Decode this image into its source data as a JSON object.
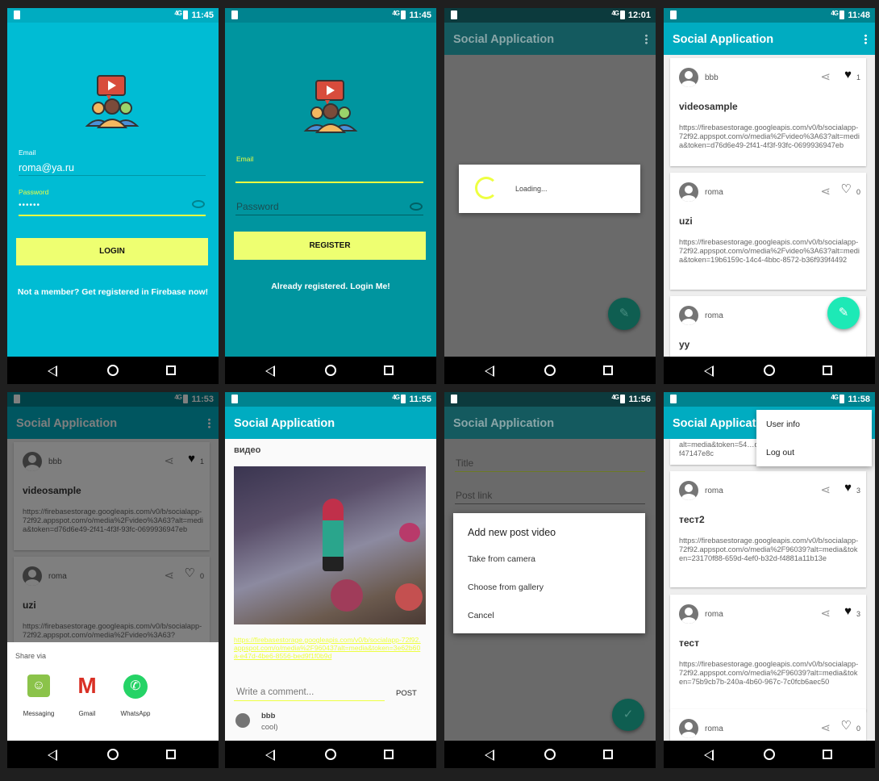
{
  "colors": {
    "cyan": "#00bcd4",
    "teal": "#00acc1",
    "dark_teal": "#00838f",
    "yellow": "#eeff41",
    "fab_green": "#1de9b6",
    "status_dark": "#0097a7"
  },
  "icons": {
    "logo": "video-people-logo",
    "share": "share-icon",
    "heart_filled": "heart-filled-icon",
    "heart_empty": "heart-outline-icon",
    "edit": "pencil-icon",
    "check": "check-icon",
    "eye": "eye-icon",
    "overflow": "kebab-menu-icon"
  },
  "screens": {
    "login": {
      "time": "11:45",
      "net": "4G",
      "email_label": "Email",
      "email_value": "roma@ya.ru",
      "password_label": "Password",
      "password_value": "••••••",
      "button": "LOGIN",
      "link": "Not a member? Get registered in Firebase now!"
    },
    "register": {
      "time": "11:45",
      "net": "4G",
      "email_label": "Email",
      "password_placeholder": "Password",
      "button": "REGISTER",
      "link": "Already registered. Login Me!"
    },
    "loading": {
      "time": "12:01",
      "net": "4G",
      "app_title": "Social Application",
      "dialog_text": "Loading..."
    },
    "feed": {
      "time": "11:48",
      "net": "4G",
      "app_title": "Social Application",
      "posts": [
        {
          "user": "bbb",
          "likes": "1",
          "liked": true,
          "title": "videosample",
          "url": "https://firebasestorage.googleapis.com/v0/b/socialapp-72f92.appspot.com/o/media%2Fvideo%3A63?alt=media&token=d76d6e49-2f41-4f3f-93fc-0699936947eb"
        },
        {
          "user": "roma",
          "likes": "0",
          "liked": false,
          "title": "uzi",
          "url": "https://firebasestorage.googleapis.com/v0/b/socialapp-72f92.appspot.com/o/media%2Fvideo%3A63?alt=media&token=19b6159c-14c4-4bbc-8572-b36f939f4492"
        },
        {
          "user": "roma",
          "likes": "",
          "liked": false,
          "title": "yy",
          "url": ""
        }
      ]
    },
    "share": {
      "time": "11:53",
      "net": "4G",
      "app_title": "Social Application",
      "title": "Share via",
      "apps": [
        "Messaging",
        "Gmail",
        "WhatsApp"
      ],
      "posts": [
        {
          "user": "bbb",
          "likes": "1",
          "liked": true,
          "title": "videosample",
          "url": "https://firebasestorage.googleapis.com/v0/b/socialapp-72f92.appspot.com/o/media%2Fvideo%3A63?alt=media&token=d76d6e49-2f41-4f3f-93fc-0699936947eb"
        },
        {
          "user": "roma",
          "likes": "0",
          "liked": false,
          "title": "uzi",
          "url": "https://firebasestorage.googleapis.com/v0/b/socialapp-72f92.appspot.com/o/media%2Fvideo%3A63?"
        }
      ]
    },
    "detail": {
      "time": "11:55",
      "net": "4G",
      "app_title": "Social Application",
      "post_title": "видео",
      "url": "https://firebasestorage.googleapis.com/v0/b/socialapp-72f92.appspot.com/o/media%2F960437alt=media&token=3e62b60a-e47d-4be6-8556-bed9f1f0b9d",
      "comment_placeholder": "Write a comment...",
      "post_button": "POST",
      "comment_user": "bbb",
      "comment_text": "cool)"
    },
    "new_post": {
      "time": "11:56",
      "net": "4G",
      "app_title": "Social Application",
      "title_placeholder": "Title",
      "link_placeholder": "Post link",
      "dialog_title": "Add new post video",
      "options": [
        "Take from camera",
        "Choose from gallery",
        "Cancel"
      ]
    },
    "menu": {
      "time": "11:58",
      "net": "4G",
      "app_title": "Social Application",
      "menu_items": [
        "User info",
        "Log out"
      ],
      "top_url": "alt=media&token=54…d91f47147e8c",
      "posts": [
        {
          "user": "roma",
          "likes": "3",
          "liked": true,
          "title": "тест2",
          "url": "https://firebasestorage.googleapis.com/v0/b/socialapp-72f92.appspot.com/o/media%2F96039?alt=media&token=23170f88-659d-4ef0-b32d-f4881a11b13e"
        },
        {
          "user": "roma",
          "likes": "3",
          "liked": true,
          "title": "тест",
          "url": "https://firebasestorage.googleapis.com/v0/b/socialapp-72f92.appspot.com/o/media%2F96039?alt=media&token=75b9cb7b-240a-4b60-967c-7c0fcb6aec50"
        },
        {
          "user": "roma",
          "likes": "0",
          "liked": false,
          "title": "",
          "url": ""
        }
      ]
    }
  }
}
